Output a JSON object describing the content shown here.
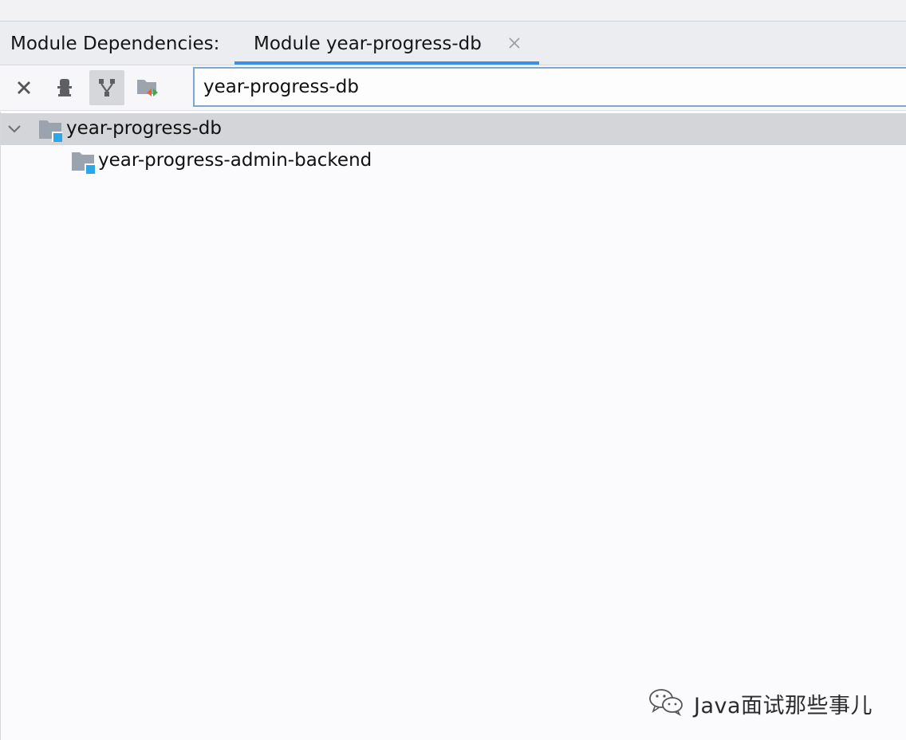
{
  "tabbar": {
    "title": "Module Dependencies:",
    "active_tab_label": "Module year-progress-db"
  },
  "toolbar": {
    "buttons": [
      {
        "icon": "close-icon"
      },
      {
        "icon": "person-icon"
      },
      {
        "icon": "dependency-graph-icon",
        "active": true
      },
      {
        "icon": "module-folder-arrows-icon"
      }
    ]
  },
  "search": {
    "value": "year-progress-db"
  },
  "tree": {
    "root": {
      "label": "year-progress-db",
      "expanded": true,
      "selected": true,
      "icon": "module-folder-icon"
    },
    "children": [
      {
        "label": "year-progress-admin-backend",
        "icon": "module-folder-icon"
      }
    ]
  },
  "watermark": {
    "text": "Java面试那些事儿",
    "icon": "wechat-icon"
  },
  "colors": {
    "accent": "#3d8fe0",
    "selection": "#d4d5d8",
    "module_badge": "#2aa7e8"
  }
}
